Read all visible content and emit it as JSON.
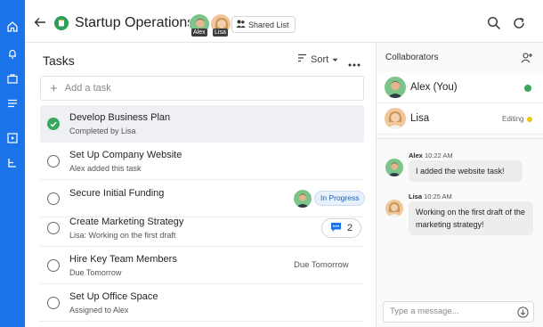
{
  "app": {
    "title": "Startup Operations",
    "shared_label": "Shared List",
    "members": [
      "Alex",
      "Lisa"
    ]
  },
  "tasks_panel": {
    "title": "Tasks",
    "sort_label": "Sort",
    "add_placeholder": "Add a task",
    "items": [
      {
        "title": "Develop Business Plan",
        "subtitle": "Completed by Lisa",
        "done": true
      },
      {
        "title": "Set Up Company Website",
        "subtitle": "Alex added this task",
        "done": false
      },
      {
        "title": "Secure Initial Funding",
        "subtitle": "",
        "done": false,
        "status": "In Progress",
        "assignee": "Alex"
      },
      {
        "title": "Create Marketing Strategy",
        "subtitle": "Lisa: Working on the first draft",
        "done": false,
        "comments": "2"
      },
      {
        "title": "Hire Key Team Members",
        "subtitle": "Due Tomorrow",
        "done": false,
        "due": "Due Tomorrow"
      },
      {
        "title": "Set Up Office Space",
        "subtitle": "Assigned to Alex",
        "done": false
      }
    ]
  },
  "collaborators": {
    "title": "Collaborators",
    "people": [
      {
        "name": "Alex (You)",
        "status": "online"
      },
      {
        "name": "Lisa",
        "status": "Editing"
      }
    ]
  },
  "chat": {
    "messages": [
      {
        "author": "Alex",
        "time": "10:22 AM",
        "text": "I added the website task!"
      },
      {
        "author": "Lisa",
        "time": "10:25 AM",
        "text": "Working on the first draft of the marketing strategy!"
      }
    ],
    "input_placeholder": "Type a message..."
  },
  "colors": {
    "rail": "#1a73e8",
    "done": "#36a85a",
    "online": "#3aa45a",
    "editing": "#f3c20c",
    "status_pill": "#1c5fb3"
  }
}
